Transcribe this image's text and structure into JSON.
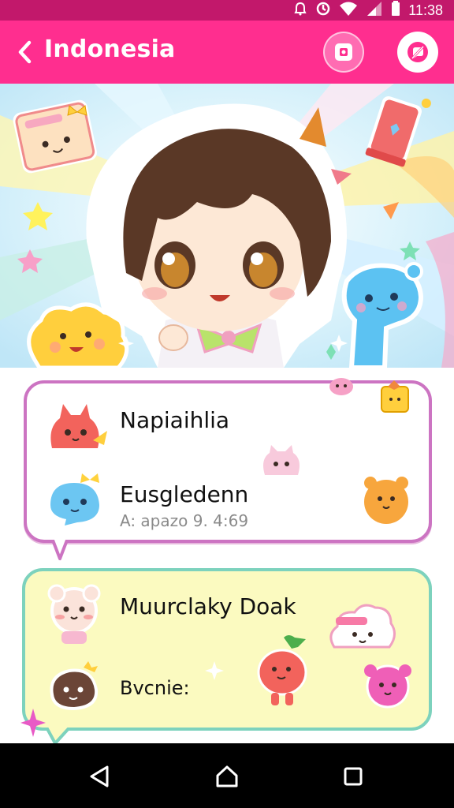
{
  "status_bar": {
    "time": "11:38",
    "icons": [
      "notification-icon",
      "sync-icon",
      "wifi-icon",
      "signal-icon",
      "battery-icon"
    ]
  },
  "app_bar": {
    "title": "Indonesia",
    "back_icon": "chevron-left-icon",
    "actions": [
      "camera-icon",
      "chat-bubble-icon"
    ]
  },
  "hero": {
    "description_icons": [
      "chibi-avatar",
      "cat-sticker",
      "lantern-sticker",
      "dinosaur-sticker",
      "cloud-sticker"
    ]
  },
  "cards": [
    {
      "items": [
        {
          "name": "Napiaihlia",
          "sub": ""
        },
        {
          "name": "Eusgledenn",
          "sub": "A: apazo 9. 4:69"
        }
      ]
    },
    {
      "items": [
        {
          "name": "Muurclaky Doak",
          "sub": ""
        },
        {
          "name": "Bvcnie:",
          "sub": ""
        }
      ]
    }
  ],
  "colors": {
    "status_bar": "#c2186b",
    "app_bar": "#ff2e8f",
    "card1_border": "#cc74c2",
    "card2_border": "#7dd2bd",
    "card2_fill": "#fbfac0"
  },
  "nav_bar": {
    "buttons": [
      "back-triangle-icon",
      "home-icon",
      "recents-icon"
    ]
  }
}
